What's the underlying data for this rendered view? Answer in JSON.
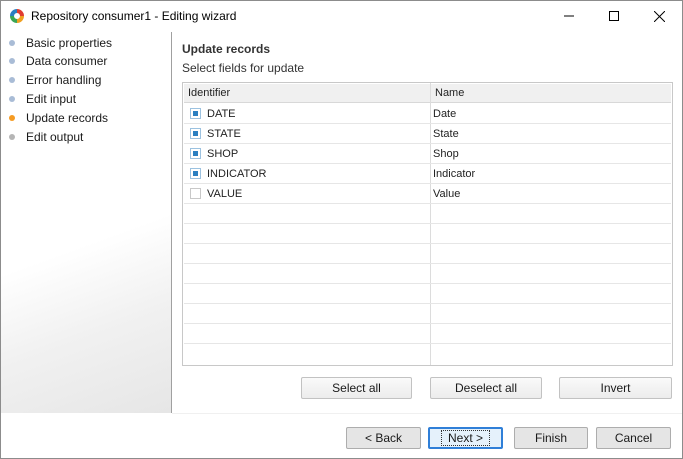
{
  "window": {
    "title": "Repository consumer1 - Editing wizard",
    "controls": {
      "minimize": "minimize",
      "maximize": "maximize",
      "close": "close"
    }
  },
  "sidebar": {
    "items": [
      {
        "label": "Basic properties",
        "state": "done",
        "color": "#a9bcd6"
      },
      {
        "label": "Data consumer",
        "state": "done",
        "color": "#a9bcd6"
      },
      {
        "label": "Error handling",
        "state": "done",
        "color": "#a9bcd6"
      },
      {
        "label": "Edit input",
        "state": "done",
        "color": "#a9bcd6"
      },
      {
        "label": "Update records",
        "state": "current",
        "color": "#f59b23"
      },
      {
        "label": "Edit output",
        "state": "pending",
        "color": "#b5b5b5"
      }
    ]
  },
  "main": {
    "heading": "Update records",
    "subheading": "Select fields for update",
    "grid": {
      "columns": [
        "Identifier",
        "Name"
      ],
      "rows": [
        {
          "identifier": "DATE",
          "name": "Date",
          "checked": true
        },
        {
          "identifier": "STATE",
          "name": "State",
          "checked": true
        },
        {
          "identifier": "SHOP",
          "name": "Shop",
          "checked": true
        },
        {
          "identifier": "INDICATOR",
          "name": "Indicator",
          "checked": true
        },
        {
          "identifier": "VALUE",
          "name": "Value",
          "checked": false
        }
      ]
    },
    "actions": {
      "select_all": "Select all",
      "deselect_all": "Deselect all",
      "invert": "Invert"
    }
  },
  "footer": {
    "back": "< Back",
    "next": "Next >",
    "finish": "Finish",
    "cancel": "Cancel"
  },
  "colors": {
    "accent": "#2f7fd8",
    "checkbox_fill": "#2a7fc1"
  }
}
